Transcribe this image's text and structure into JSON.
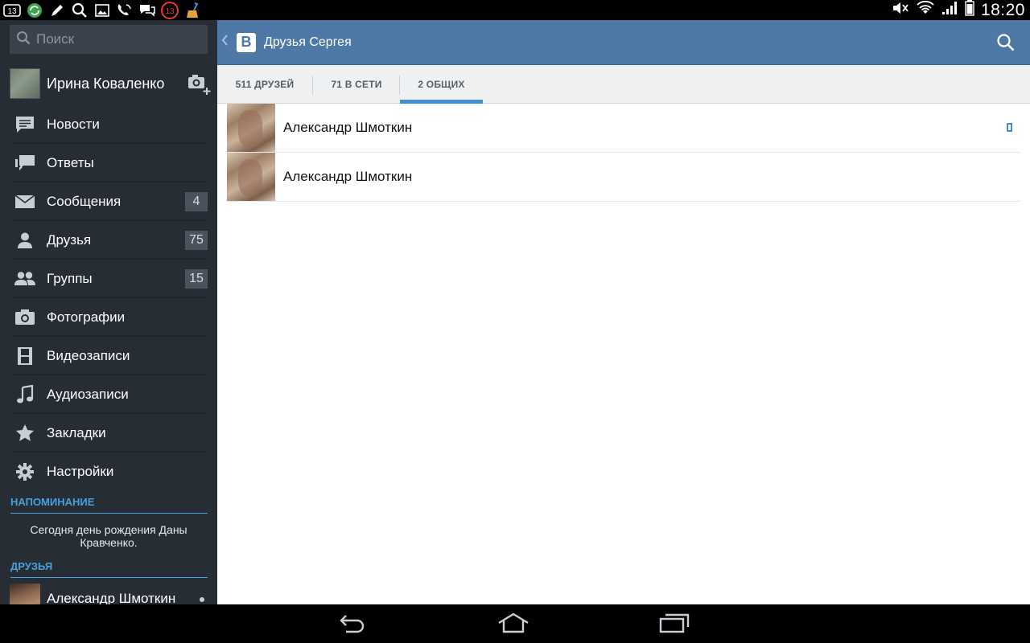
{
  "statusbar": {
    "left_icons": [
      "notification-13-icon",
      "sync-icon",
      "pen-icon",
      "search-icon",
      "image-icon",
      "phone-icon",
      "chat-icon",
      "badge-13-icon",
      "broom-icon"
    ],
    "left_badge_1": "13",
    "left_badge_2": "13",
    "time": "18:20"
  },
  "sidebar": {
    "search_placeholder": "Поиск",
    "profile_name": "Ирина Коваленко",
    "menu": [
      {
        "label": "Новости",
        "icon": "news-icon",
        "badge": ""
      },
      {
        "label": "Ответы",
        "icon": "replies-icon",
        "badge": ""
      },
      {
        "label": "Сообщения",
        "icon": "mail-icon",
        "badge": "4"
      },
      {
        "label": "Друзья",
        "icon": "friend-icon",
        "badge": "75"
      },
      {
        "label": "Группы",
        "icon": "groups-icon",
        "badge": "15"
      },
      {
        "label": "Фотографии",
        "icon": "camera-icon",
        "badge": ""
      },
      {
        "label": "Видеозаписи",
        "icon": "film-icon",
        "badge": ""
      },
      {
        "label": "Аудиозаписи",
        "icon": "music-note-icon",
        "badge": ""
      },
      {
        "label": "Закладки",
        "icon": "star-icon",
        "badge": ""
      },
      {
        "label": "Настройки",
        "icon": "gear-icon",
        "badge": ""
      }
    ],
    "reminder_title": "НАПОМИНАНИЕ",
    "reminder_text": "Сегодня день рождения Даны Кравченко.",
    "friends_title": "ДРУЗЬЯ",
    "friend_name": "Александр Шмоткин"
  },
  "header": {
    "logo": "В",
    "title": "Друзья Сергея"
  },
  "tabs": [
    {
      "label": "511 ДРУЗЕЙ",
      "active": false
    },
    {
      "label": "71 В СЕТИ",
      "active": false
    },
    {
      "label": "2 ОБЩИХ",
      "active": true
    }
  ],
  "friends": [
    {
      "name": "Александр Шмоткин",
      "mobile": true
    },
    {
      "name": "Александр Шмоткин",
      "mobile": false
    }
  ],
  "colors": {
    "sidebar_bg": "#272d35",
    "header_bg": "#4e79a6",
    "accent": "#3e8fd1"
  }
}
